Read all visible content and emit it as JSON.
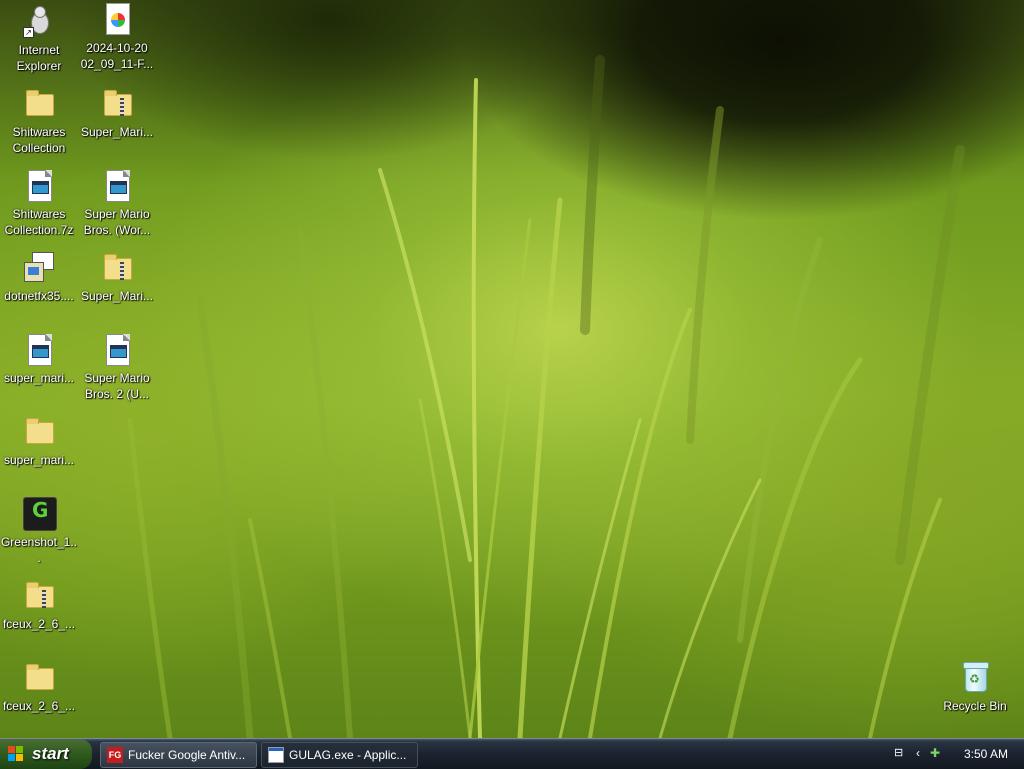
{
  "desktop": {
    "icons": [
      {
        "line1": "Internet",
        "line2": "Explorer",
        "icon": "internet-explorer-icon"
      },
      {
        "line1": "2024-10-20",
        "line2": "02_09_11-F...",
        "icon": "image-file-icon"
      },
      {
        "line1": "Shitwares",
        "line2": "Collection",
        "icon": "folder-icon"
      },
      {
        "line1": "Super_Mari...",
        "line2": "",
        "icon": "zip-folder-icon"
      },
      {
        "line1": "Shitwares",
        "line2": "Collection.7z",
        "icon": "archive-file-icon"
      },
      {
        "line1": "Super Mario",
        "line2": "Bros. (Wor...",
        "icon": "rom-file-icon"
      },
      {
        "line1": "dotnetfx35....",
        "line2": "",
        "icon": "installer-icon"
      },
      {
        "line1": "Super_Mari...",
        "line2": "",
        "icon": "zip-folder-icon"
      },
      {
        "line1": "super_mari...",
        "line2": "",
        "icon": "rom-file-icon"
      },
      {
        "line1": "Super Mario",
        "line2": "Bros. 2 (U...",
        "icon": "rom-file-icon"
      },
      {
        "line1": "super_mari...",
        "line2": "",
        "icon": "folder-icon"
      },
      {
        "line1": "Greenshot_1...",
        "line2": "",
        "icon": "greenshot-icon"
      },
      {
        "line1": "fceux_2_6_...",
        "line2": "",
        "icon": "zip-folder-icon"
      },
      {
        "line1": "fceux_2_6_...",
        "line2": "",
        "icon": "folder-icon"
      },
      {
        "line1": "Recycle Bin",
        "line2": "",
        "icon": "recycle-bin-icon"
      }
    ]
  },
  "taskbar": {
    "start_label": "start",
    "tasks": [
      {
        "label": "Fucker Google Antiv...",
        "icon_text": "FG",
        "active": false
      },
      {
        "label": "GULAG.exe - Applic...",
        "active": true
      }
    ],
    "tray": {
      "clock": "3:50 AM"
    }
  },
  "colors": {
    "taskbar": "#1b232e",
    "start_button": "#2f5a1e",
    "wallpaper_accent": "#84ad28"
  }
}
